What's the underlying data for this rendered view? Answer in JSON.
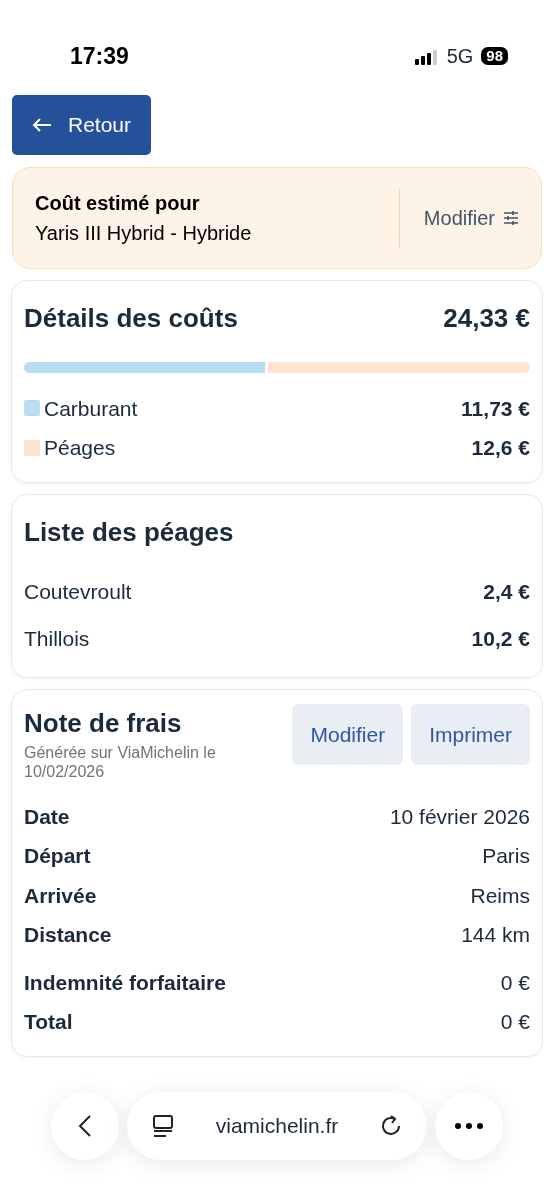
{
  "status_bar": {
    "time": "17:39",
    "network": "5G",
    "battery": "98"
  },
  "back_button": {
    "label": "Retour"
  },
  "vehicle": {
    "title": "Coût estimé pour",
    "name": "Yaris III Hybrid - Hybride",
    "action": "Modifier"
  },
  "cost_details": {
    "title": "Détails des coûts",
    "total": "24,33 €",
    "items": [
      {
        "label": "Carburant",
        "amount": "11,73 €",
        "color": "#b8dcf0",
        "level": 0.482
      },
      {
        "label": "Péages",
        "amount": "12,6 €",
        "color": "#fde3d0"
      }
    ]
  },
  "tolls": {
    "title": "Liste des péages",
    "items": [
      {
        "name": "Coutevroult",
        "amount": "2,4 €"
      },
      {
        "name": "Thillois",
        "amount": "10,2 €"
      }
    ]
  },
  "expense_note": {
    "title": "Note de frais",
    "subtitle": "Générée sur ViaMichelin le 10/02/2026",
    "buttons": [
      "Modifier",
      "Imprimer"
    ],
    "rows": [
      {
        "label": "Date",
        "value": "10 février 2026"
      },
      {
        "label": "Départ",
        "value": "Paris"
      },
      {
        "label": "Arrivée",
        "value": "Reims"
      },
      {
        "label": "Distance",
        "value": "144 km"
      }
    ],
    "totals": [
      {
        "label": "Indemnité forfaitaire",
        "value": "0 €"
      },
      {
        "label": "Total",
        "value": "0 €"
      }
    ]
  },
  "browser_bar": {
    "url": "viamichelin.fr"
  }
}
